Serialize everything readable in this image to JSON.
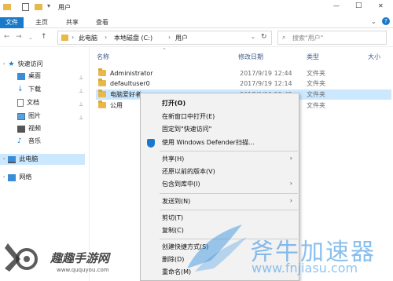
{
  "window": {
    "title": "用户",
    "controls": {
      "minimize": "—",
      "maximize": "□",
      "close": "✕"
    }
  },
  "ribbon": {
    "tabs": [
      "文件",
      "主页",
      "共享",
      "查看"
    ]
  },
  "address": {
    "segments": [
      "此电脑",
      "本地磁盘 (C:)",
      "用户"
    ],
    "search_placeholder": "搜索\"用户\""
  },
  "sidebar": {
    "items": [
      {
        "label": "快速访问",
        "icon": "star-icon"
      },
      {
        "label": "桌面",
        "icon": "desktop-icon"
      },
      {
        "label": "下载",
        "icon": "download-icon"
      },
      {
        "label": "文档",
        "icon": "document-icon"
      },
      {
        "label": "图片",
        "icon": "pictures-icon"
      },
      {
        "label": "视频",
        "icon": "video-icon"
      },
      {
        "label": "音乐",
        "icon": "music-icon"
      },
      {
        "label": "此电脑",
        "icon": "computer-icon"
      },
      {
        "label": "网络",
        "icon": "network-icon"
      }
    ]
  },
  "columns": {
    "name": "名称",
    "date": "修改日期",
    "type": "类型",
    "size": "大小"
  },
  "files": [
    {
      "name": "Administrator",
      "date": "2017/9/19 12:44",
      "type": "文件夹"
    },
    {
      "name": "defaultuser0",
      "date": "2017/9/19 12:14",
      "type": "文件夹"
    },
    {
      "name": "电脑爱好者",
      "date": "2017/9/19 12:42",
      "type": "文件夹"
    },
    {
      "name": "公用",
      "date": "",
      "type": "文件夹"
    }
  ],
  "context_menu": {
    "items": [
      "打开(O)",
      "在新窗口中打开(E)",
      "固定到\"快速访问\"",
      "使用 Windows Defender扫描...",
      "共享(H)",
      "还原以前的版本(V)",
      "包含到库中(I)",
      "发送到(N)",
      "剪切(T)",
      "复制(C)",
      "创建快捷方式(S)",
      "删除(D)",
      "重命名(M)"
    ]
  },
  "watermarks": {
    "left_brand": "趣趣手游网",
    "left_url": "www.ququyou.com",
    "right_brand": "斧牛加速器",
    "right_url": "www.fnjiasu.com"
  },
  "colors": {
    "accent": "#1979ca",
    "selection": "#cce8ff",
    "folder": "#e8b84a"
  }
}
